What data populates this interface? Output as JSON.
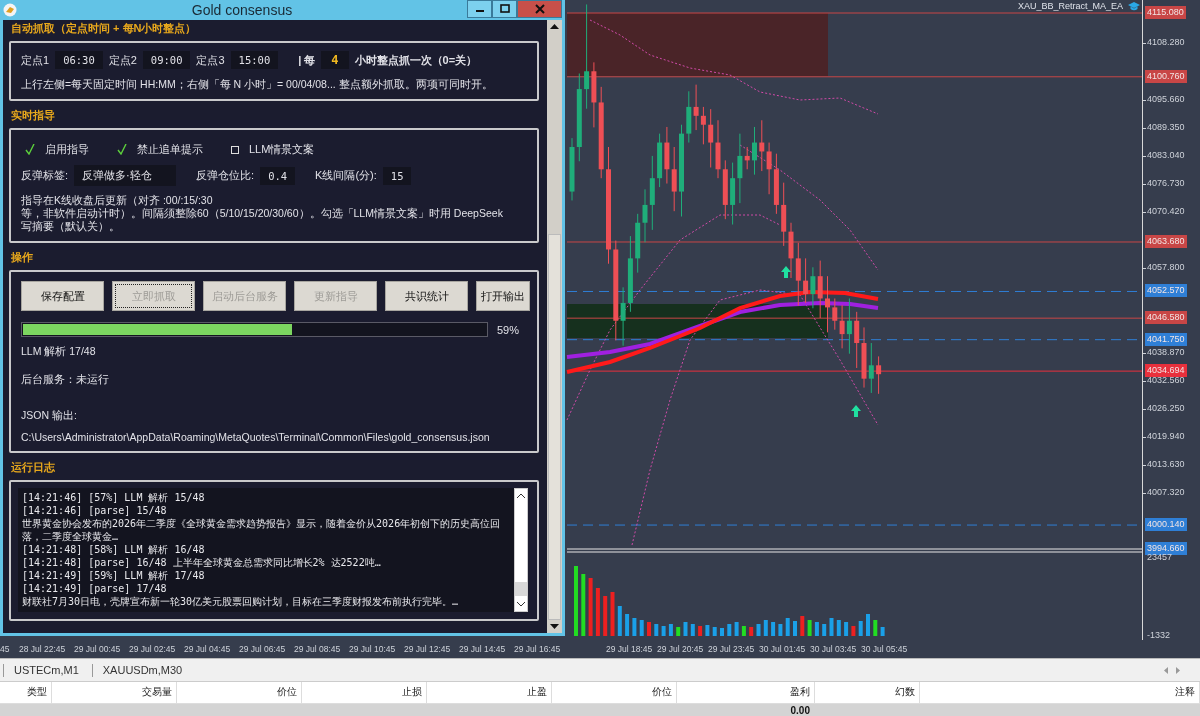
{
  "dialog": {
    "title": "Gold consensus",
    "auto_fetch": {
      "heading": "自动抓取（定点时间 + 每N小时整点）",
      "times": [
        {
          "label": "定点1",
          "value": "06:30"
        },
        {
          "label": "定点2",
          "value": "09:00"
        },
        {
          "label": "定点3",
          "value": "15:00"
        }
      ],
      "every_label": "| 每",
      "every_value": "4",
      "every_suffix": "小时整点抓一次（0=关）",
      "note": "上行左侧=每天固定时间 HH:MM；右侧「每 N 小时」= 00/04/08... 整点额外抓取。两项可同时开。"
    },
    "guidance": {
      "heading": "实时指导",
      "checkboxes": [
        {
          "label": "启用指导",
          "checked": true
        },
        {
          "label": "禁止追单提示",
          "checked": true
        },
        {
          "label": "LLM情景文案",
          "checked": false
        }
      ],
      "fields": [
        {
          "label": "反弹标签:",
          "value": "反弹做多·轻仓"
        },
        {
          "label": "反弹仓位比:",
          "value": "0.4"
        },
        {
          "label": "K线间隔(分):",
          "value": "15"
        }
      ],
      "note": "指导在K线收盘后更新（对齐 :00/:15/:30\n等，非软件启动计时）。间隔须整除60（5/10/15/20/30/60）。勾选「LLM情景文案」时用 DeepSeek\n写摘要（默认关）。"
    },
    "operations": {
      "heading": "操作",
      "buttons": [
        {
          "label": "保存配置",
          "disabled": false,
          "focused": false
        },
        {
          "label": "立即抓取",
          "disabled": true,
          "focused": true
        },
        {
          "label": "启动后台服务",
          "disabled": true,
          "focused": false
        },
        {
          "label": "更新指导",
          "disabled": true,
          "focused": false
        },
        {
          "label": "共识统计",
          "disabled": false,
          "focused": false
        },
        {
          "label": "打开输出",
          "disabled": false,
          "focused": false
        }
      ],
      "progress": {
        "level": 0.58,
        "reading": "59%"
      },
      "status": "LLM 解析 17/48",
      "service": "后台服务：未运行",
      "output_label": "JSON 输出:",
      "output_path": "C:\\Users\\Administrator\\AppData\\Roaming\\MetaQuotes\\Terminal\\Common\\Files\\gold_consensus.json"
    },
    "log": {
      "heading": "运行日志",
      "lines": [
        "[14:21:46] [57%] LLM 解析 15/48",
        "[14:21:46] [parse] 15/48",
        "世界黄金协会发布的2026年二季度《全球黄金需求趋势报告》显示，随着金价从2026年初创下的历史高位回落，二季度全球黄金…",
        "[14:21:48] [58%] LLM 解析 16/48",
        "[14:21:48] [parse] 16/48 上半年全球黄金总需求同比增长2% 达2522吨…",
        "[14:21:49] [59%] LLM 解析 17/48",
        "[14:21:49] [parse] 17/48",
        "财联社7月30日电，壳牌宣布新一轮30亿美元股票回购计划，目标在三季度财报发布前执行完毕。…"
      ]
    }
  },
  "chart": {
    "indicator": "XAU_BB_Retract_MA_EA",
    "price_ticks": [
      "4108.280",
      "4095.660",
      "4089.350",
      "4083.040",
      "4076.730",
      "4070.420",
      "4057.800",
      "4038.870",
      "4032.560",
      "4026.250",
      "4019.940",
      "4013.630",
      "4007.320"
    ],
    "levels": [
      {
        "price": "4115.080",
        "kind": "solid",
        "color": "#c84646"
      },
      {
        "price": "4100.760",
        "kind": "solid",
        "color": "#c84646"
      },
      {
        "price": "4063.680",
        "kind": "solid",
        "color": "#c84646"
      },
      {
        "price": "4052.570",
        "kind": "dashed",
        "color": "#2f7fd6"
      },
      {
        "price": "4046.580",
        "kind": "solid",
        "color": "#c84646"
      },
      {
        "price": "4041.750",
        "kind": "dashed",
        "color": "#2f7fd6"
      },
      {
        "price": "4034.694",
        "kind": "solid",
        "color": "#e8303c"
      },
      {
        "price": "4000.140",
        "kind": "dashed",
        "color": "#2f7fd6"
      },
      {
        "price": "3994.660",
        "kind": "separator",
        "color": "#2f7fd6"
      }
    ],
    "volume_ticks": [
      "23457",
      "-1332"
    ],
    "time_labels": [
      "45",
      "28 Jul 22:45",
      "29 Jul 00:45",
      "29 Jul 02:45",
      "29 Jul 04:45",
      "29 Jul 06:45",
      "29 Jul 08:45",
      "29 Jul 10:45",
      "29 Jul 12:45",
      "29 Jul 14:45",
      "29 Jul 16:45",
      "29 Jul 18:45",
      "29 Jul 20:45",
      "29 Jul 23:45",
      "30 Jul 01:45",
      "30 Jul 03:45",
      "30 Jul 05:45"
    ]
  },
  "chart_tabs": [
    "USTECm,M1",
    "XAUUSDm,M30"
  ],
  "trade_table": {
    "columns": [
      "类型",
      "交易量",
      "价位",
      "止损",
      "止盈",
      "价位",
      "盈利",
      "幻数",
      "注释"
    ],
    "total_profit": "0.00"
  }
}
